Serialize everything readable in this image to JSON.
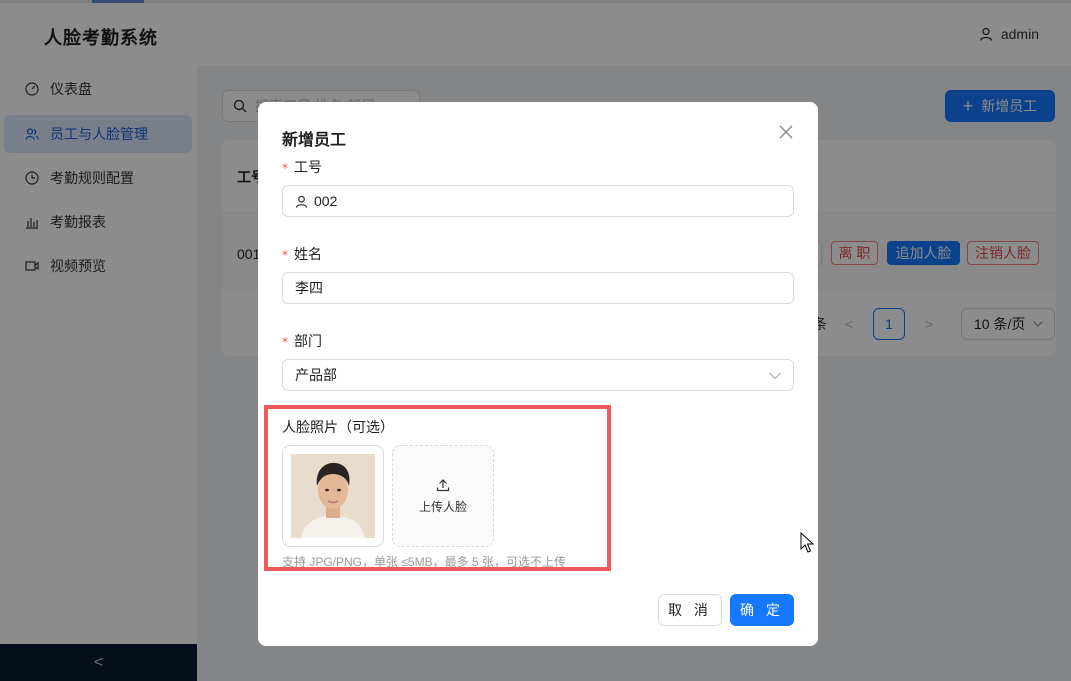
{
  "header": {
    "title": "人脸考勤系统",
    "user": "admin"
  },
  "sidebar": {
    "items": [
      {
        "label": "仪表盘",
        "icon": "dashboard-icon",
        "active": false
      },
      {
        "label": "员工与人脸管理",
        "icon": "user-group-icon",
        "active": true
      },
      {
        "label": "考勤规则配置",
        "icon": "clock-icon",
        "active": false
      },
      {
        "label": "考勤报表",
        "icon": "bar-chart-icon",
        "active": false
      },
      {
        "label": "视频预览",
        "icon": "video-icon",
        "active": false
      }
    ],
    "collapse": "<"
  },
  "main": {
    "search_placeholder": "搜索工号/姓名/部门",
    "add_button": "新增员工",
    "table": {
      "header_first": "工号",
      "rows": [
        {
          "id": "001",
          "actions": [
            "离 职",
            "追加人脸",
            "注销人脸"
          ]
        }
      ]
    },
    "pagination": {
      "prev": "<",
      "current": "1",
      "next": ">",
      "page_size": "10 条/页",
      "total_suffix": "条"
    }
  },
  "modal": {
    "title": "新增员工",
    "fields": {
      "id": {
        "label": "工号",
        "required": true,
        "value": "002"
      },
      "name": {
        "label": "姓名",
        "required": true,
        "value": "李四"
      },
      "dept": {
        "label": "部门",
        "required": true,
        "value": "产品部"
      }
    },
    "upload": {
      "label": "人脸照片（可选）",
      "button": "上传人脸",
      "hint": "支持 JPG/PNG，单张 ≤5MB，最多 5 张，可选不上传"
    },
    "cancel": "取 消",
    "ok": "确 定"
  },
  "colors": {
    "primary": "#1677ff",
    "danger": "#ff4d4f",
    "highlight": "#f05a5a",
    "sidebar_dark": "#0b1a33"
  }
}
